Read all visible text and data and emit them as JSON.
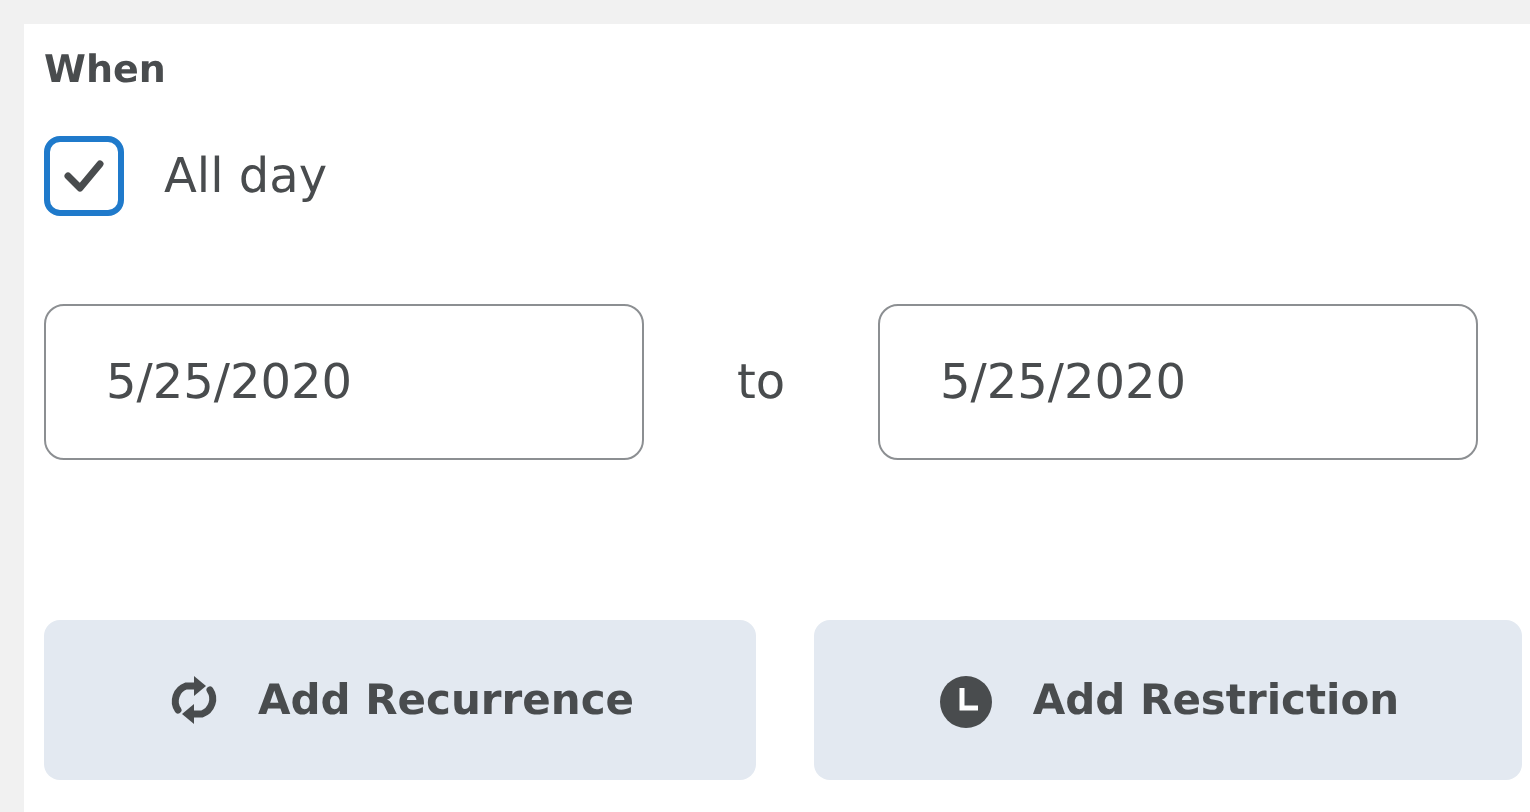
{
  "section": {
    "title": "When"
  },
  "all_day": {
    "label": "All day",
    "checked": true
  },
  "date_range": {
    "start": {
      "value": "5/25/2020"
    },
    "separator": "to",
    "end": {
      "value": "5/25/2020"
    }
  },
  "buttons": [
    {
      "kind": "recurrence",
      "label": "Add Recurrence"
    },
    {
      "kind": "restriction",
      "label": "Add Restriction"
    }
  ]
}
